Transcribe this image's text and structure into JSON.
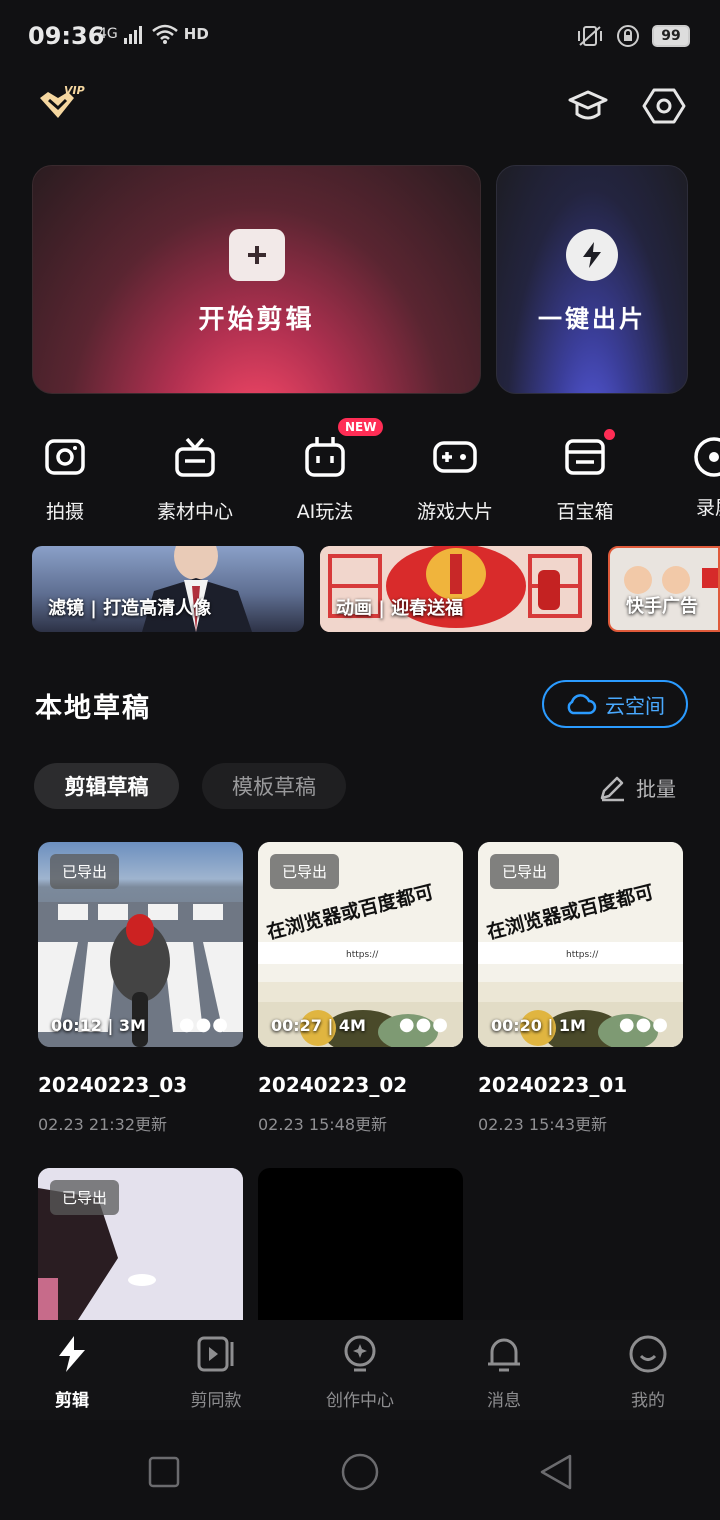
{
  "status_bar": {
    "time": "09:36",
    "network": "4G",
    "hd": "HD",
    "battery": "99"
  },
  "header": {
    "vip_label": "VIP"
  },
  "hero": {
    "start_edit": "开始剪辑",
    "one_click": "一键出片"
  },
  "tools": [
    {
      "label": "拍摄",
      "icon": "camera-icon"
    },
    {
      "label": "素材中心",
      "icon": "tv-icon"
    },
    {
      "label": "AI玩法",
      "icon": "robot-icon",
      "badge": "NEW"
    },
    {
      "label": "游戏大片",
      "icon": "gamepad-icon"
    },
    {
      "label": "百宝箱",
      "icon": "toolbox-icon"
    },
    {
      "label": "录屏",
      "icon": "record-icon"
    }
  ],
  "banners": [
    {
      "text": "滤镜 | 打造高清人像"
    },
    {
      "text": "动画 | 迎春送福"
    },
    {
      "text": "快手广告"
    }
  ],
  "drafts_section": {
    "title": "本地草稿",
    "cloud_button": "云空间",
    "tabs": [
      "剪辑草稿",
      "模板草稿"
    ],
    "batch": "批量"
  },
  "drafts": [
    {
      "title": "20240223_03",
      "date": "02.23 21:32更新",
      "duration": "00:12",
      "size": "3M",
      "exported": "已导出"
    },
    {
      "title": "20240223_02",
      "date": "02.23 15:48更新",
      "duration": "00:27",
      "size": "4M",
      "exported": "已导出"
    },
    {
      "title": "20240223_01",
      "date": "02.23 15:43更新",
      "duration": "00:20",
      "size": "1M",
      "exported": "已导出"
    },
    {
      "exported": "已导出"
    }
  ],
  "thumb_text": {
    "overlay": "在浏览器或百度都可",
    "small_url": "https://"
  },
  "bottom_nav": [
    {
      "label": "剪辑",
      "icon": "bolt-icon",
      "active": true
    },
    {
      "label": "剪同款",
      "icon": "video-template-icon"
    },
    {
      "label": "创作中心",
      "icon": "lightbulb-icon"
    },
    {
      "label": "消息",
      "icon": "bell-icon"
    },
    {
      "label": "我的",
      "icon": "profile-icon"
    }
  ],
  "colors": {
    "background": "#111113",
    "accent_blue": "#2b9bff",
    "badge_red": "#ff2d55",
    "hero_pink": "#ff4b6a",
    "hero_blue": "#5a5ee8"
  }
}
